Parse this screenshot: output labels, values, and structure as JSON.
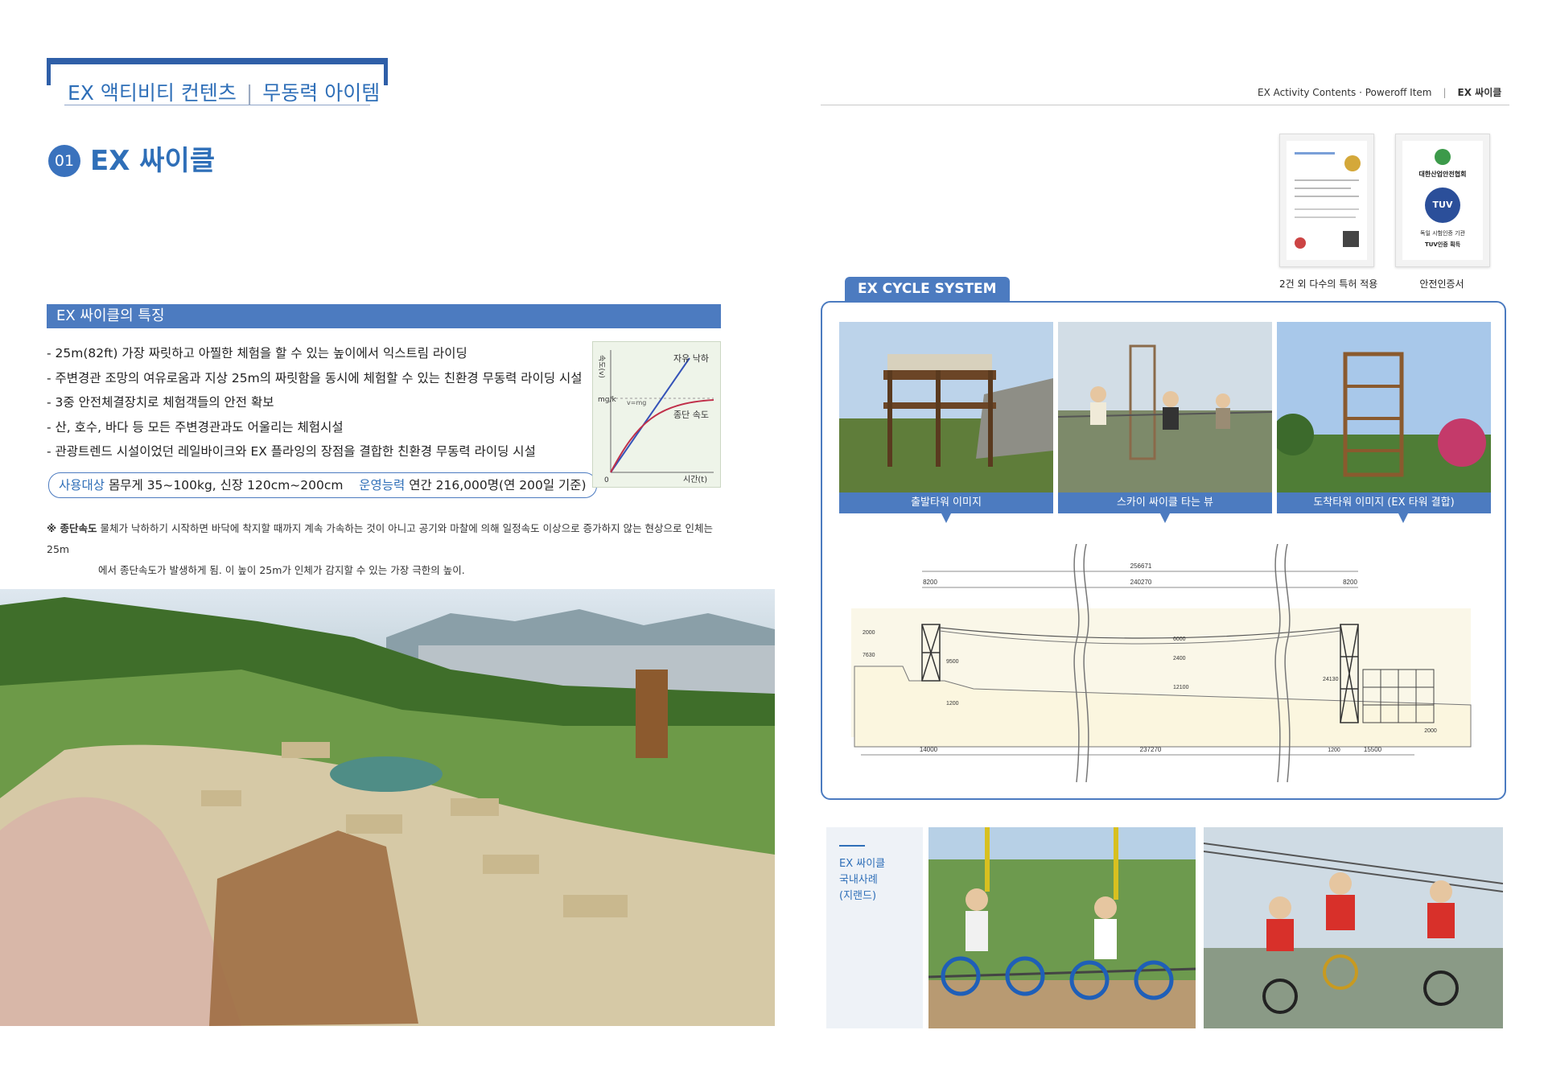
{
  "left": {
    "tag": {
      "part1": "EX 액티비티 컨텐츠",
      "sep": "|",
      "part2": "무동력 아이템"
    },
    "section_number": "01",
    "title": "EX 싸이클",
    "feature_heading": "EX 싸이클의 특징",
    "bullets": [
      "- 25m(82ft) 가장 짜릿하고 아찔한 체험을 할 수 있는 높이에서 익스트림 라이딩",
      "- 주변경관 조망의 여유로움과 지상 25m의 짜릿함을 동시에 체험할 수 있는 친환경 무동력 라이딩 시설",
      "- 3중 안전체결장치로 체험객들의 안전 확보",
      "- 산, 호수, 바다 등 모든 주변경관과도 어울리는 체험시설",
      "- 관광트렌드 시설이었던 레일바이크와 EX 플라잉의 장점을 결합한 친환경 무동력 라이딩 시설"
    ],
    "target": {
      "label1": "사용대상",
      "value1": "몸무게 35~100kg, 신장 120cm~200cm",
      "label2": "운영능력",
      "value2": "연간 216,000명(연 200일 기준)"
    },
    "note": {
      "prefix": "※ 종단속도",
      "line1": "물체가 낙하하기 시작하면 바닥에 착지할 때까지 계속 가속하는 것이 아니고 공기와 마찰에 의해 일정속도 이상으로 증가하지 않는 현상으로 인체는 25m",
      "line2": "에서 종단속도가 발생하게 됨. 이 높이 25m가 인체가 감지할 수 있는 가장 극한의 높이."
    },
    "graph": {
      "ylabel": "속도(v)",
      "ylabel2": "mg/k",
      "xlabel": "시간(t)",
      "origin": "0",
      "curve1": "자유 낙하",
      "curve2": "종단 속도",
      "mid": "v=mg"
    }
  },
  "right": {
    "header": {
      "part1": "EX Activity Contents · Poweroff Item",
      "sep": "|",
      "part2": "EX 싸이클"
    },
    "certs": [
      {
        "caption": "2건 외 다수의 특허 적용"
      },
      {
        "caption": "안전인증서",
        "org": "대한산업안전협회",
        "badge": "TUV",
        "line1": "독일 시험인증 기관",
        "line2": "TUV인증 획득"
      }
    ],
    "system_tab": "EX CYCLE SYSTEM",
    "photo_labels": [
      "출발타워 이미지",
      "스카이 싸이클 타는 뷰",
      "도착타워 이미지 (EX 타워 결합)"
    ],
    "drawing": {
      "dims_top": [
        "256671",
        "8200",
        "240270",
        "8200"
      ],
      "dims_bottom": [
        "14000",
        "237270",
        "1200",
        "15500",
        "2000"
      ],
      "dims_vert": [
        "2000",
        "7630",
        "9500",
        "1200",
        "6000",
        "2400",
        "12100",
        "24130"
      ]
    },
    "case": {
      "line1": "EX 싸이클",
      "line2": "국내사례",
      "line3": "(지랜드)"
    }
  },
  "colors": {
    "accent": "#2f6fb8",
    "band": "#4c7bc0"
  }
}
